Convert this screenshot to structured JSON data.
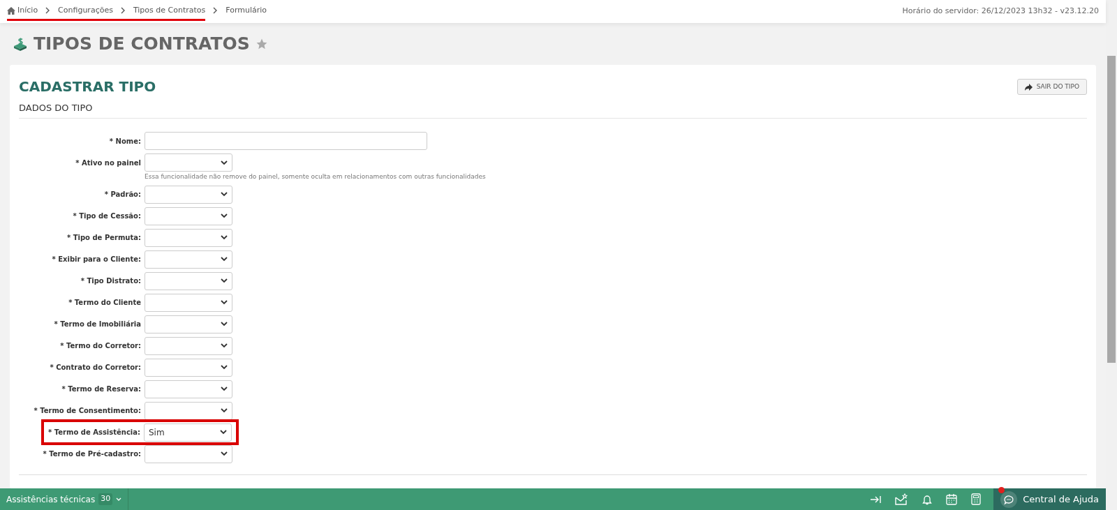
{
  "breadcrumb": [
    {
      "label": "Início",
      "underlined": true
    },
    {
      "label": "Configurações",
      "underlined": true
    },
    {
      "label": "Tipos de Contratos",
      "underlined": true
    },
    {
      "label": "Formulário",
      "underlined": false
    }
  ],
  "server_info": "Horário do servidor: 26/12/2023 13h32 - v23.12.20",
  "page_title": "TIPOS DE CONTRATOS",
  "form": {
    "title": "CADASTRAR TIPO",
    "exit_button": "SAIR DO TIPO",
    "section": "DADOS DO TIPO",
    "fields": [
      {
        "kind": "text",
        "label": "* Nome:",
        "highlighted": false
      },
      {
        "kind": "select",
        "label": "* Ativo no painel",
        "highlighted": false,
        "hint": "Essa funcionalidade não remove do painel, somente oculta em relacionamentos com outras funcionalidades"
      },
      {
        "kind": "select",
        "label": "* Padrão:",
        "highlighted": false
      },
      {
        "kind": "select",
        "label": "* Tipo de Cessão:",
        "highlighted": false
      },
      {
        "kind": "select",
        "label": "* Tipo de Permuta:",
        "highlighted": false
      },
      {
        "kind": "select",
        "label": "* Exibir para o Cliente:",
        "highlighted": false
      },
      {
        "kind": "select",
        "label": "* Tipo Distrato:",
        "highlighted": false
      },
      {
        "kind": "select",
        "label": "* Termo do Cliente",
        "highlighted": false
      },
      {
        "kind": "select",
        "label": "* Termo de Imobiliária",
        "highlighted": false
      },
      {
        "kind": "select",
        "label": "* Termo do Corretor:",
        "highlighted": false
      },
      {
        "kind": "select",
        "label": "* Contrato do Corretor:",
        "highlighted": false
      },
      {
        "kind": "select",
        "label": "* Termo de Reserva:",
        "highlighted": false
      },
      {
        "kind": "select",
        "label": "* Termo de Consentimento:",
        "highlighted": false
      },
      {
        "kind": "select",
        "label": "* Termo de Assistência:",
        "value": "Sim",
        "highlighted": true
      },
      {
        "kind": "select",
        "label": "* Termo de Pré-cadastro:",
        "highlighted": false
      }
    ]
  },
  "bottom_bar": {
    "label": "Assistências técnicas",
    "count": "30",
    "help": "Central de Ajuda",
    "help_notification": true
  }
}
